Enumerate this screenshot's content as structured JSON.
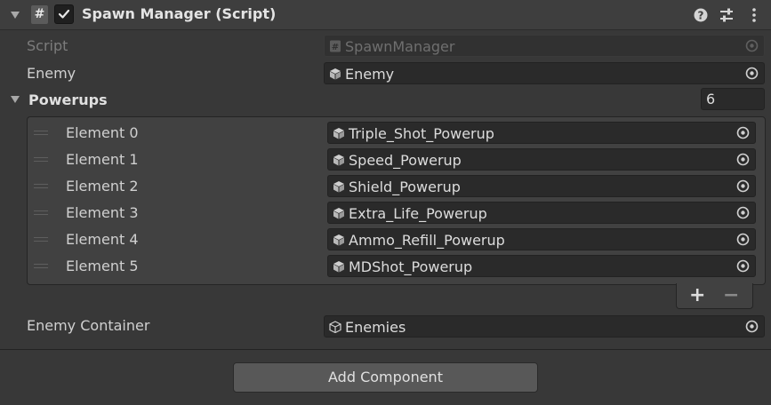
{
  "component": {
    "title": "Spawn Manager (Script)",
    "script_badge": "#",
    "enabled": true
  },
  "fields": {
    "script_label": "Script",
    "script_value": "SpawnManager",
    "enemy_label": "Enemy",
    "enemy_value": "Enemy",
    "powerups_label": "Powerups",
    "powerups_count": "6",
    "enemy_container_label": "Enemy Container",
    "enemy_container_value": "Enemies"
  },
  "powerups": [
    {
      "label": "Element 0",
      "value": "Triple_Shot_Powerup"
    },
    {
      "label": "Element 1",
      "value": "Speed_Powerup"
    },
    {
      "label": "Element 2",
      "value": "Shield_Powerup"
    },
    {
      "label": "Element 3",
      "value": "Extra_Life_Powerup"
    },
    {
      "label": "Element 4",
      "value": "Ammo_Refill_Powerup"
    },
    {
      "label": "Element 5",
      "value": "MDShot_Powerup"
    }
  ],
  "list_controls": {
    "add": "+",
    "remove": "−"
  },
  "add_component_label": "Add Component",
  "icons": {
    "header": [
      "help-icon",
      "settings-sliders-icon",
      "more-vert-icon"
    ],
    "prefab": "prefab-cube-icon",
    "picker": "object-picker-icon"
  },
  "colors": {
    "background": "#383838",
    "header": "#3e3e3e",
    "field": "#2a2a2a",
    "button": "#585858"
  }
}
